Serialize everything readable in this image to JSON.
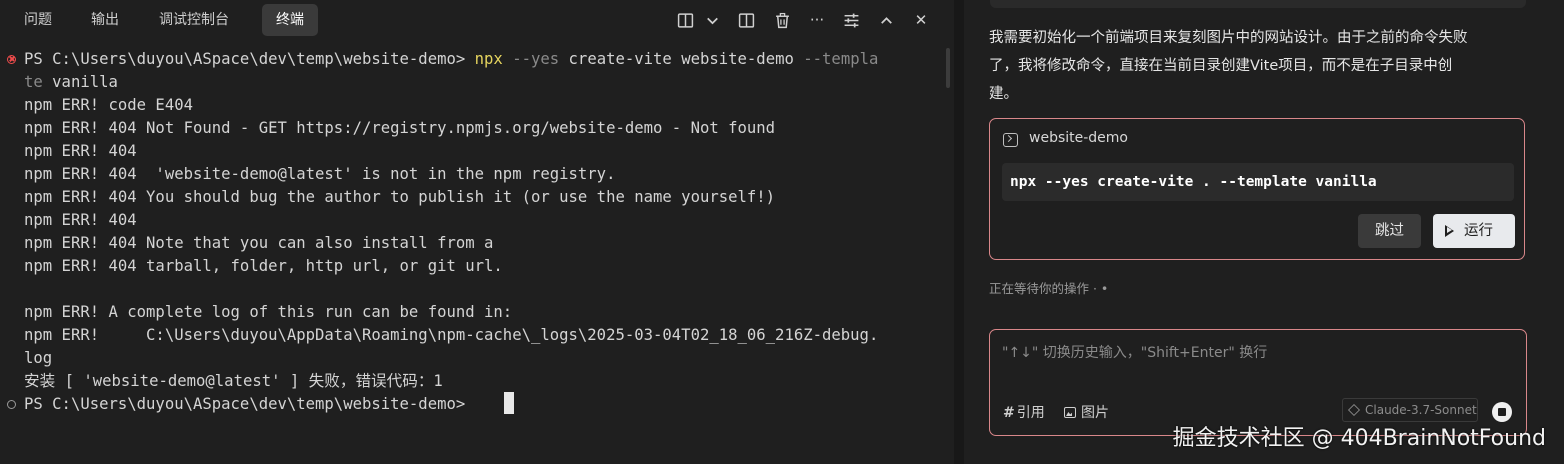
{
  "tabs": [
    {
      "label": "问题",
      "active": false
    },
    {
      "label": "输出",
      "active": false
    },
    {
      "label": "调试控制台",
      "active": false
    },
    {
      "label": "终端",
      "active": true
    }
  ],
  "toolbar_icons": [
    "split-terminal-icon",
    "chevron-down-icon",
    "split-panel-icon",
    "trash-icon",
    "more-icon",
    "terminal-settings-icon",
    "chevron-up-icon",
    "close-icon"
  ],
  "toolbar_glyphs": {
    "more": "···",
    "close": "✕"
  },
  "terminal": {
    "lines": [
      {
        "marker": "error",
        "segments": [
          {
            "text": "PS C:\\Users\\duyou\\ASpace\\dev\\temp\\website-demo> ",
            "style": "plain"
          },
          {
            "text": "npx",
            "style": "cmd"
          },
          {
            "text": " --yes",
            "style": "dim"
          },
          {
            "text": " create-vite website-demo",
            "style": "arg"
          },
          {
            "text": " --templa",
            "style": "dim"
          }
        ]
      },
      {
        "marker": "",
        "segments": [
          {
            "text": "te",
            "style": "dim"
          },
          {
            "text": " vanilla",
            "style": "arg"
          }
        ]
      },
      {
        "marker": "",
        "segments": [
          {
            "text": "npm ERR! code E404",
            "style": "plain"
          }
        ]
      },
      {
        "marker": "",
        "segments": [
          {
            "text": "npm ERR! 404 Not Found - GET https://registry.npmjs.org/website-demo - Not found",
            "style": "plain"
          }
        ]
      },
      {
        "marker": "",
        "segments": [
          {
            "text": "npm ERR! 404",
            "style": "plain"
          }
        ]
      },
      {
        "marker": "",
        "segments": [
          {
            "text": "npm ERR! 404  'website-demo@latest' is not in the npm registry.",
            "style": "plain"
          }
        ]
      },
      {
        "marker": "",
        "segments": [
          {
            "text": "npm ERR! 404 You should bug the author to publish it (or use the name yourself!)",
            "style": "plain"
          }
        ]
      },
      {
        "marker": "",
        "segments": [
          {
            "text": "npm ERR! 404",
            "style": "plain"
          }
        ]
      },
      {
        "marker": "",
        "segments": [
          {
            "text": "npm ERR! 404 Note that you can also install from a",
            "style": "plain"
          }
        ]
      },
      {
        "marker": "",
        "segments": [
          {
            "text": "npm ERR! 404 tarball, folder, http url, or git url.",
            "style": "plain"
          }
        ]
      },
      {
        "marker": "",
        "segments": [
          {
            "text": "",
            "style": "plain"
          }
        ]
      },
      {
        "marker": "",
        "segments": [
          {
            "text": "npm ERR! A complete log of this run can be found in:",
            "style": "plain"
          }
        ]
      },
      {
        "marker": "",
        "segments": [
          {
            "text": "npm ERR!     C:\\Users\\duyou\\AppData\\Roaming\\npm-cache\\_logs\\2025-03-04T02_18_06_216Z-debug.",
            "style": "plain"
          }
        ]
      },
      {
        "marker": "",
        "segments": [
          {
            "text": "log",
            "style": "plain"
          }
        ]
      },
      {
        "marker": "",
        "segments": [
          {
            "text": "安装 [ 'website-demo@latest' ] 失败，错误代码：1",
            "style": "plain"
          }
        ]
      },
      {
        "marker": "ok",
        "segments": [
          {
            "text": "PS C:\\Users\\duyou\\ASpace\\dev\\temp\\website-demo> ",
            "style": "plain"
          }
        ]
      }
    ]
  },
  "chat": {
    "message_line1": "我需要初始化一个前端项目来复刻图片中的网站设计。由于之前的命令失败",
    "message_line2": "了，我将修改命令，直接在当前目录创建Vite项目，而不是在子目录中创",
    "message_line3": "建。",
    "command_card": {
      "title": "website-demo",
      "command": "npx --yes create-vite . --template vanilla",
      "skip_label": "跳过",
      "run_label": "运行"
    },
    "status_text": "正在等待你的操作 · •",
    "input": {
      "placeholder": "\"↑↓\" 切换历史输入，\"Shift+Enter\" 换行",
      "value": "",
      "ref_label": "引用",
      "ref_glyph": "#",
      "image_label": "图片",
      "model_label": "Claude-3.7-Sonnet"
    }
  },
  "watermark": "掘金技术社区 @ 404BrainNotFound"
}
